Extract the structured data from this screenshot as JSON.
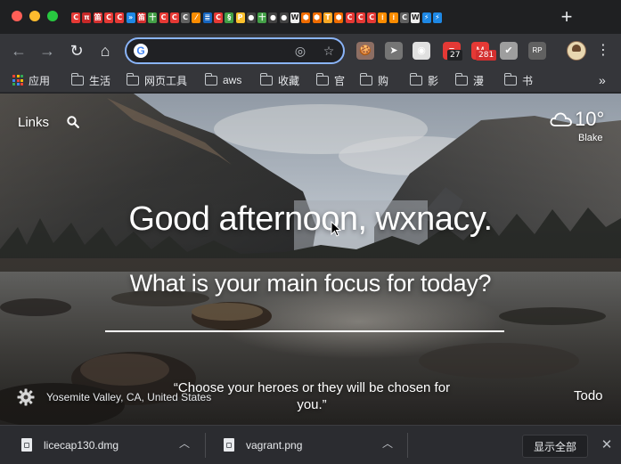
{
  "browser": {
    "tab_favicons": [
      {
        "icon": "chrome-c-icon",
        "glyph": "C",
        "color": "#e53935"
      },
      {
        "icon": "csdn-icon",
        "glyph": "π",
        "color": "#c62828"
      },
      {
        "icon": "bookmark-icon",
        "glyph": "笛",
        "color": "#d32f2f"
      },
      {
        "icon": "chrome-c-icon",
        "glyph": "C",
        "color": "#e53935"
      },
      {
        "icon": "chrome-c-icon",
        "glyph": "C",
        "color": "#e53935"
      },
      {
        "icon": "double-chevron-icon",
        "glyph": "»",
        "color": "#1e88e5"
      },
      {
        "icon": "bookmark-icon",
        "glyph": "笛",
        "color": "#d32f2f"
      },
      {
        "icon": "cross-icon",
        "glyph": "十",
        "color": "#43a047"
      },
      {
        "icon": "chrome-c-icon",
        "glyph": "C",
        "color": "#e53935"
      },
      {
        "icon": "chrome-c-icon",
        "glyph": "C",
        "color": "#e53935"
      },
      {
        "icon": "chrome-c-icon",
        "glyph": "C",
        "color": "#616161"
      },
      {
        "icon": "slash-icon",
        "glyph": "⁄",
        "color": "#fb8c00"
      },
      {
        "icon": "tag-icon",
        "glyph": "≣",
        "color": "#1565c0"
      },
      {
        "icon": "chrome-c-icon",
        "glyph": "C",
        "color": "#e53935"
      },
      {
        "icon": "swirl-icon",
        "glyph": "§",
        "color": "#43a047"
      },
      {
        "icon": "python-icon",
        "glyph": "P",
        "color": "#fbc02d"
      },
      {
        "icon": "github-icon",
        "glyph": "●",
        "color": "#424242"
      },
      {
        "icon": "cross-icon",
        "glyph": "十",
        "color": "#43a047"
      },
      {
        "icon": "github-icon",
        "glyph": "●",
        "color": "#424242"
      },
      {
        "icon": "github-icon",
        "glyph": "●",
        "color": "#424242"
      },
      {
        "icon": "wiki-icon",
        "glyph": "W",
        "color": "#eeeeee"
      },
      {
        "icon": "hex-icon",
        "glyph": "⬢",
        "color": "#ef6c00"
      },
      {
        "icon": "hex-icon",
        "glyph": "⬢",
        "color": "#ef6c00"
      },
      {
        "icon": "bookmark-icon",
        "glyph": "T",
        "color": "#f9a825"
      },
      {
        "icon": "hex-icon",
        "glyph": "⬢",
        "color": "#ef6c00"
      },
      {
        "icon": "chrome-c-icon",
        "glyph": "C",
        "color": "#e53935"
      },
      {
        "icon": "chrome-c-icon",
        "glyph": "C",
        "color": "#e53935"
      },
      {
        "icon": "chrome-c-icon",
        "glyph": "C",
        "color": "#e53935"
      },
      {
        "icon": "chevrons-icon",
        "glyph": "⁞",
        "color": "#fb8c00"
      },
      {
        "icon": "chevrons-icon",
        "glyph": "⁞",
        "color": "#fb8c00"
      },
      {
        "icon": "chrome-c-icon",
        "glyph": "C",
        "color": "#616161"
      },
      {
        "icon": "wiki-icon",
        "glyph": "W",
        "color": "#eeeeee"
      },
      {
        "icon": "bolt-icon",
        "glyph": "⚡",
        "color": "#1e88e5"
      },
      {
        "icon": "bolt-icon",
        "glyph": "⚡",
        "color": "#1e88e5"
      }
    ],
    "new_tab_glyph": "+",
    "omnibox": {
      "value": "",
      "placeholder": ""
    },
    "extensions": [
      {
        "icon": "cookie-icon",
        "glyph": "🍪",
        "color": "#8d6e63",
        "badge": ""
      },
      {
        "icon": "arrow-icon",
        "glyph": "➤",
        "color": "#757575",
        "badge": ""
      },
      {
        "icon": "eye-icon",
        "glyph": "◉",
        "color": "#e0e0e0",
        "badge": ""
      },
      {
        "icon": "todoist-icon",
        "glyph": "≡",
        "color": "#e53935",
        "badge": "27"
      },
      {
        "icon": "gmail-icon",
        "glyph": "M",
        "color": "#e53935",
        "badge": "281"
      },
      {
        "icon": "check-icon",
        "glyph": "✔",
        "color": "#9e9e9e",
        "badge": ""
      },
      {
        "icon": "rp-icon",
        "glyph": "RP",
        "color": "#616161",
        "badge": ""
      }
    ],
    "badge_colors": {
      "todoist": "#202124",
      "gmail": "#d32f2f"
    },
    "bookmarks": [
      {
        "label": "应用",
        "icon": "apps-grid-icon"
      },
      {
        "label": "生活",
        "icon": "folder-icon"
      },
      {
        "label": "网页工具",
        "icon": "folder-icon"
      },
      {
        "label": "aws",
        "icon": "folder-icon"
      },
      {
        "label": "收藏",
        "icon": "folder-icon"
      },
      {
        "label": "官",
        "icon": "folder-icon"
      },
      {
        "label": "购",
        "icon": "folder-icon"
      },
      {
        "label": "影",
        "icon": "folder-icon"
      },
      {
        "label": "漫",
        "icon": "folder-icon"
      },
      {
        "label": "书",
        "icon": "folder-icon"
      }
    ],
    "bookmarks_more": "»"
  },
  "momentum": {
    "links_label": "Links",
    "weather": {
      "temp": "10°",
      "location": "Blake",
      "icon": "cloud-icon"
    },
    "greeting": "Good afternoon, wxnacy.",
    "focus_question": "What is your main focus for today?",
    "focus_input": {
      "value": "",
      "placeholder": ""
    },
    "photo_location": "Yosemite Valley, CA, United States",
    "quote": "“Choose your heroes or they will be chosen for you.”",
    "todo_label": "Todo"
  },
  "downloads": {
    "items": [
      {
        "name": "licecap130.dmg",
        "icon": "file-icon"
      },
      {
        "name": "vagrant.png",
        "icon": "image-file-icon"
      }
    ],
    "show_all_label": "显示全部",
    "close_glyph": "✕"
  }
}
